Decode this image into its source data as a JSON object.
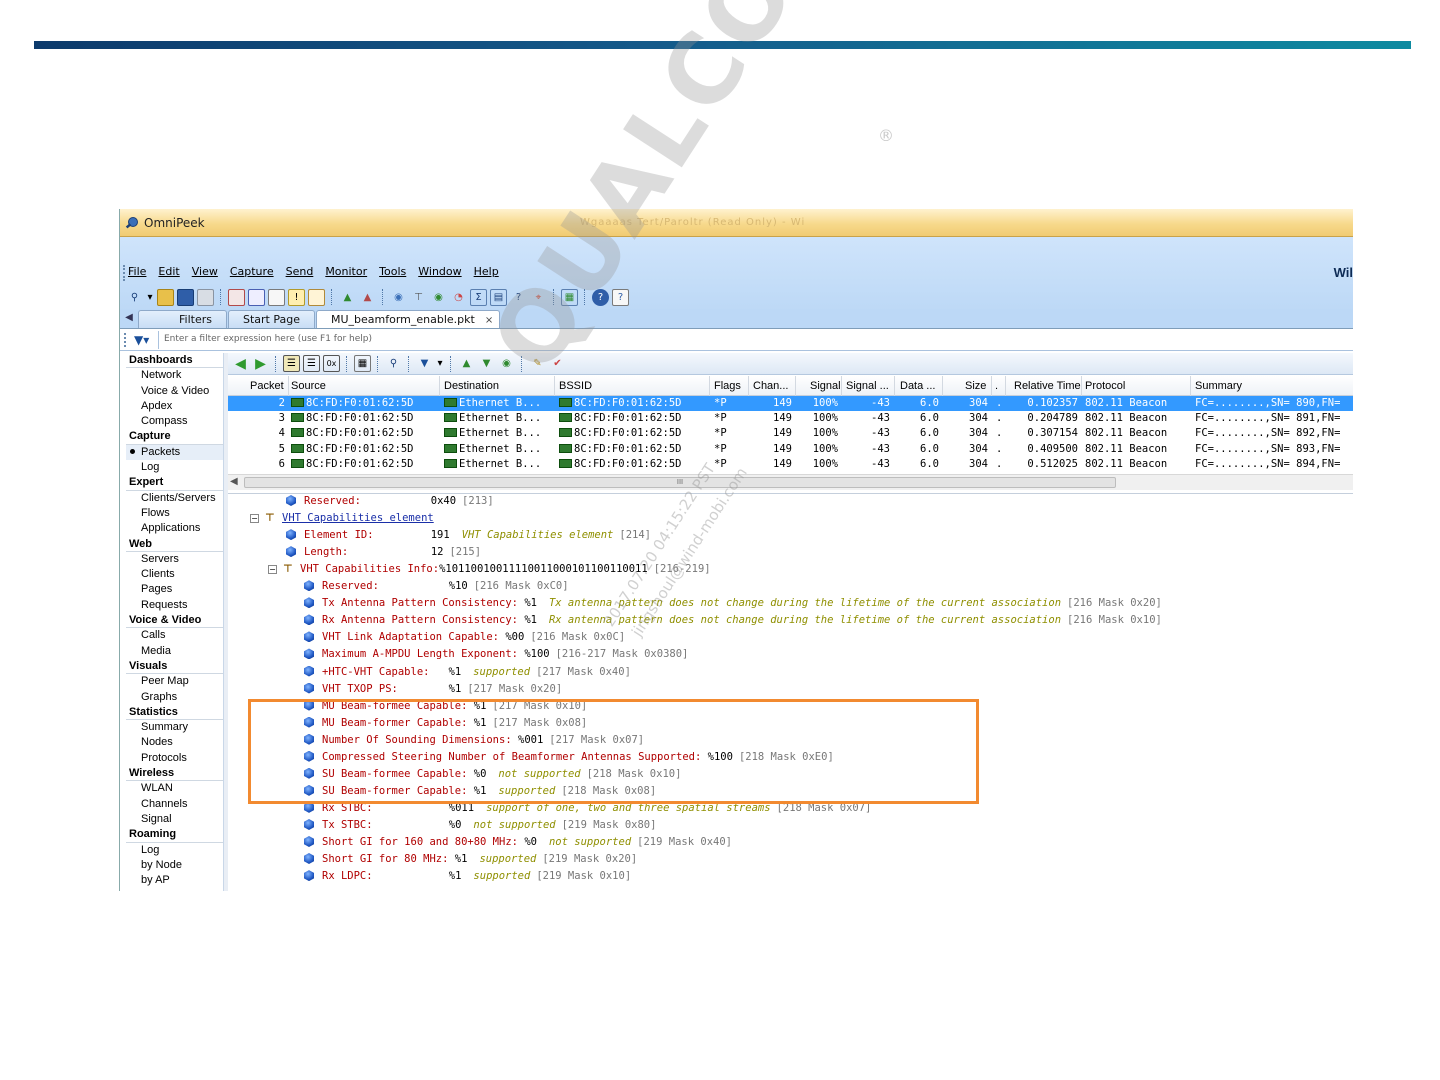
{
  "window": {
    "title": "OmniPeek",
    "blurred_title": "Wgaaaas Tert/Paroltr (Read Only) - Wi",
    "brand": "Wil"
  },
  "menu": [
    "File",
    "Edit",
    "View",
    "Capture",
    "Send",
    "Monitor",
    "Tools",
    "Window",
    "Help"
  ],
  "tabs": [
    {
      "label": "Filters"
    },
    {
      "label": "Start Page"
    },
    {
      "label": "MU_beamform_enable.pkt",
      "close": "×"
    }
  ],
  "filter": {
    "placeholder": "Enter a filter expression here (use F1 for help)"
  },
  "nav": {
    "dashboards": "Dashboards",
    "network": "Network",
    "voice_video": "Voice & Video",
    "apdex": "Apdex",
    "compass": "Compass",
    "capture": "Capture",
    "packets": "Packets",
    "log": "Log",
    "expert": "Expert",
    "clients_servers": "Clients/Servers",
    "flows": "Flows",
    "applications": "Applications",
    "web": "Web",
    "servers": "Servers",
    "clients": "Clients",
    "pages": "Pages",
    "requests": "Requests",
    "voice_video_grp": "Voice & Video",
    "calls": "Calls",
    "media": "Media",
    "visuals": "Visuals",
    "peer_map": "Peer Map",
    "graphs": "Graphs",
    "statistics": "Statistics",
    "summary": "Summary",
    "nodes": "Nodes",
    "protocols": "Protocols",
    "wireless": "Wireless",
    "wlan": "WLAN",
    "channels": "Channels",
    "signal": "Signal",
    "roaming": "Roaming",
    "roam_log": "Log",
    "by_node": "by Node",
    "by_ap": "by AP"
  },
  "grid": {
    "headers": [
      "Packet",
      "Source",
      "Destination",
      "BSSID",
      "Flags",
      "Chan...",
      "Signal",
      "Signal ...",
      "Data ...",
      "Size",
      ".",
      "Relative Time",
      "Protocol",
      "Summary"
    ],
    "rows": [
      {
        "packet": "2",
        "source": "8C:FD:F0:01:62:5D",
        "dest": "Ethernet B...",
        "bssid": "8C:FD:F0:01:62:5D",
        "flags": "*P",
        "chan": "149",
        "signal": "100%",
        "signal_dbm": "-43",
        "data": "6.0",
        "size": "304",
        "dot": ".",
        "time": "0.102357",
        "protocol": "802.11 Beacon",
        "summary": "FC=........,SN= 890,FN="
      },
      {
        "packet": "3",
        "source": "8C:FD:F0:01:62:5D",
        "dest": "Ethernet B...",
        "bssid": "8C:FD:F0:01:62:5D",
        "flags": "*P",
        "chan": "149",
        "signal": "100%",
        "signal_dbm": "-43",
        "data": "6.0",
        "size": "304",
        "dot": ".",
        "time": "0.204789",
        "protocol": "802.11 Beacon",
        "summary": "FC=........,SN= 891,FN="
      },
      {
        "packet": "4",
        "source": "8C:FD:F0:01:62:5D",
        "dest": "Ethernet B...",
        "bssid": "8C:FD:F0:01:62:5D",
        "flags": "*P",
        "chan": "149",
        "signal": "100%",
        "signal_dbm": "-43",
        "data": "6.0",
        "size": "304",
        "dot": ".",
        "time": "0.307154",
        "protocol": "802.11 Beacon",
        "summary": "FC=........,SN= 892,FN="
      },
      {
        "packet": "5",
        "source": "8C:FD:F0:01:62:5D",
        "dest": "Ethernet B...",
        "bssid": "8C:FD:F0:01:62:5D",
        "flags": "*P",
        "chan": "149",
        "signal": "100%",
        "signal_dbm": "-43",
        "data": "6.0",
        "size": "304",
        "dot": ".",
        "time": "0.409500",
        "protocol": "802.11 Beacon",
        "summary": "FC=........,SN= 893,FN="
      },
      {
        "packet": "6",
        "source": "8C:FD:F0:01:62:5D",
        "dest": "Ethernet B...",
        "bssid": "8C:FD:F0:01:62:5D",
        "flags": "*P",
        "chan": "149",
        "signal": "100%",
        "signal_dbm": "-43",
        "data": "6.0",
        "size": "304",
        "dot": ".",
        "time": "0.512025",
        "protocol": "802.11 Beacon",
        "summary": "FC=........,SN= 894,FN="
      }
    ],
    "scroll_grip": "III"
  },
  "decode": [
    {
      "kind": "field",
      "label": "Reserved:",
      "value": "0x40",
      "desc": "",
      "offset": "[213]"
    },
    {
      "kind": "header",
      "label": "VHT Capabilities element",
      "value": "",
      "desc": "",
      "offset": ""
    },
    {
      "kind": "field",
      "label": "Element ID:",
      "value": "191",
      "desc": "VHT Capabilities element",
      "offset": "[214]"
    },
    {
      "kind": "field",
      "label": "Length:",
      "value": "12",
      "desc": "",
      "offset": "[215]"
    },
    {
      "kind": "sub",
      "label": "VHT Capabilities Info:",
      "value": "%10110010011110011000101100110011",
      "desc": "",
      "offset": "[216-219]"
    },
    {
      "kind": "field",
      "label": "Reserved:",
      "value": "%10",
      "desc": "",
      "offset": "[216 Mask 0xC0]"
    },
    {
      "kind": "field",
      "label": "Tx Antenna Pattern Consistency:",
      "value": "%1",
      "desc": "Tx antenna pattern does not change during the lifetime of the current association",
      "offset": "[216 Mask 0x20]"
    },
    {
      "kind": "field",
      "label": "Rx Antenna Pattern Consistency:",
      "value": "%1",
      "desc": "Rx antenna pattern does not change during the lifetime of the current association",
      "offset": "[216 Mask 0x10]"
    },
    {
      "kind": "field",
      "label": "VHT Link Adaptation Capable:",
      "value": "%00",
      "desc": "",
      "offset": "[216 Mask 0x0C]"
    },
    {
      "kind": "field",
      "label": "Maximum A-MPDU Length Exponent:",
      "value": "%100",
      "desc": "",
      "offset": "[216-217 Mask 0x0380]"
    },
    {
      "kind": "field",
      "label": "+HTC-VHT Capable:",
      "value": "%1",
      "desc": "supported",
      "offset": "[217 Mask 0x40]"
    },
    {
      "kind": "field",
      "label": "VHT TXOP PS:",
      "value": "%1",
      "desc": "",
      "offset": "[217 Mask 0x20]"
    },
    {
      "kind": "field",
      "label": "MU Beam-formee Capable:",
      "value": "%1",
      "desc": "",
      "offset": "[217 Mask 0x10]"
    },
    {
      "kind": "field",
      "label": "MU Beam-former Capable:",
      "value": "%1",
      "desc": "",
      "offset": "[217 Mask 0x08]"
    },
    {
      "kind": "field",
      "label": "Number Of Sounding Dimensions:",
      "value": "%001",
      "desc": "",
      "offset": "[217 Mask 0x07]"
    },
    {
      "kind": "field",
      "label": "Compressed Steering Number of Beamformer Antennas Supported:",
      "value": "%100",
      "desc": "",
      "offset": "[218 Mask 0xE0]"
    },
    {
      "kind": "field",
      "label": "SU Beam-formee Capable:",
      "value": "%0",
      "desc": "not supported",
      "offset": "[218 Mask 0x10]"
    },
    {
      "kind": "field",
      "label": "SU Beam-former Capable:",
      "value": "%1",
      "desc": "supported",
      "offset": "[218 Mask 0x08]"
    },
    {
      "kind": "field",
      "label": "Rx STBC:",
      "value": "%011",
      "desc": "support of one, two and three spatial streams",
      "offset": "[218 Mask 0x07]"
    },
    {
      "kind": "field",
      "label": "Tx STBC:",
      "value": "%0",
      "desc": "not supported",
      "offset": "[219 Mask 0x80]"
    },
    {
      "kind": "field",
      "label": "Short GI for 160 and 80+80 MHz:",
      "value": "%0",
      "desc": "not supported",
      "offset": "[219 Mask 0x40]"
    },
    {
      "kind": "field",
      "label": "Short GI for 80 MHz:",
      "value": "%1",
      "desc": "supported",
      "offset": "[219 Mask 0x20]"
    },
    {
      "kind": "field",
      "label": "Rx LDPC:",
      "value": "%1",
      "desc": "supported",
      "offset": "[219 Mask 0x10]"
    }
  ],
  "watermark": {
    "logo": "QUALCOMM",
    "reg": "®",
    "date": "2017.07.20 04:15:22 PST",
    "user": "jingshoul@wind-mobi.com"
  },
  "colors": {
    "accent_bar_start": "#0c3a6b",
    "accent_bar_end": "#0d8aa0",
    "highlight_box": "#f28a30",
    "selected_row": "#3399ff",
    "field_label": "#b00000",
    "description": "#8f8f00"
  }
}
